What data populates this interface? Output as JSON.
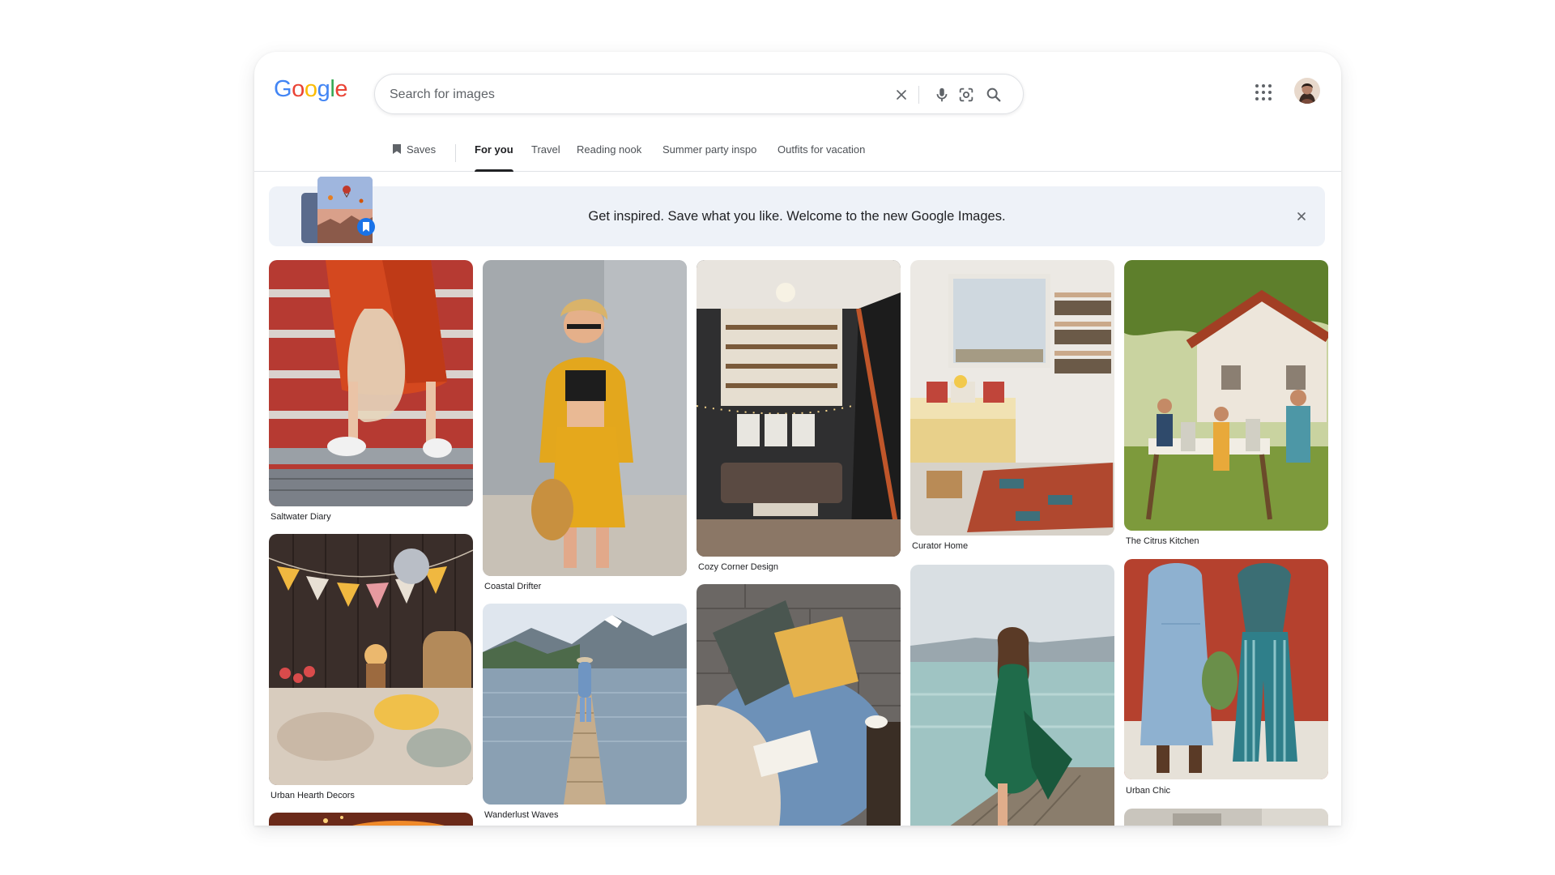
{
  "header": {
    "logo": [
      "G",
      "o",
      "o",
      "g",
      "l",
      "e"
    ],
    "logo_colors": [
      "#4285F4",
      "#EA4335",
      "#FBBC05",
      "#4285F4",
      "#34A853",
      "#EA4335"
    ],
    "search_placeholder": "Search for images",
    "icons": {
      "clear": "close-icon",
      "voice": "mic-icon",
      "lens": "lens-icon",
      "search": "search-icon",
      "apps": "apps-grid-icon",
      "avatar": "avatar"
    }
  },
  "tabs": {
    "saves": "Saves",
    "items": [
      "For you",
      "Travel",
      "Reading nook",
      "Summer party inspo",
      "Outfits for vacation"
    ],
    "active": "For you"
  },
  "banner": {
    "text": "Get inspired. Save what you like. Welcome to the new Google Images."
  },
  "feed": {
    "captions": [
      "Saltwater Diary",
      "Coastal Drifter",
      "Cozy Corner Design",
      "Curator Home",
      "The Citrus Kitchen",
      "Urban Hearth Decors",
      "Wanderlust Waves",
      "Urban Chic"
    ]
  },
  "colors": {
    "accent": "#1a73e8",
    "text": "#202124",
    "muted": "#5f6368"
  }
}
